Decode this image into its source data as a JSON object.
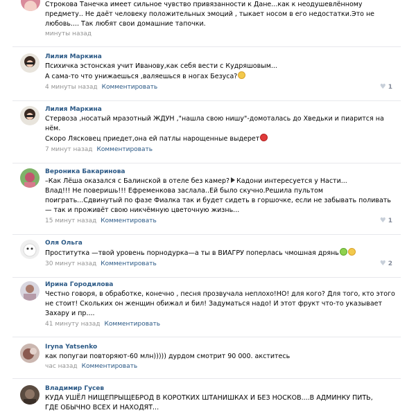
{
  "comments": [
    {
      "author": "",
      "lines": [
        "Строкова Танечка имеет сильное чувство привязанности к Дане...как к неодушевлённому",
        "предмету.. Не даёт человеку положительных эмоций , тыкает носом в его недостатки.Это не",
        "любовь.... Так любят свои домашние тапочки."
      ],
      "time": "минуты назад",
      "reply": "",
      "likes": ""
    },
    {
      "author": "Лилия Маркина",
      "lines": [
        "Психичка эстонская учит Иванову,как себя вести с Кудряшовым...",
        "А сама-то что унижаешься ,валяешься в ногах Безуса?"
      ],
      "time": "4 минуты назад",
      "reply": "Комментировать",
      "likes": "1"
    },
    {
      "author": "Лилия Маркина",
      "lines": [
        "Стервоза ,носатый мразотный ЖДУН ,\"нашла свою нишу\"-домоталась до Хведьки и пиарится на",
        "нём.",
        "Скоро Лясковец приедет,она ей патлы нарощенные выдерет"
      ],
      "time": "7 минут назад",
      "reply": "Комментировать",
      "likes": ""
    },
    {
      "author": "Вероника Бакаринова",
      "lines": [
        "–Как Лёша оказался с Балинской в отеле без камер?",
        "Кадони интересуется у Насти...",
        "Влад!!! Не поверишь!!! Ефременкова заслала..Ей было скучно.Решила пультом",
        "поиграть...Сдвинутый по фазе Фиалка так и будет сидеть в горшочке, если не забывать поливать",
        "— так и проживёт свою никчёмную цветочную жизнь..."
      ],
      "time": "15 минут назад",
      "reply": "Комментировать",
      "likes": "1"
    },
    {
      "author": "Оля Ольга",
      "lines": [
        "Проститутка —твой уровень порнодурка—а ты в ВИАГРУ поперлась чмошная дрянь"
      ],
      "time": "30 минут назад",
      "reply": "Комментировать",
      "likes": "2"
    },
    {
      "author": "Ирина Городилова",
      "lines": [
        "Честно говоря, в обработке, конечно , песня прозвучала неплохо!НО! для кого? Для того, кто этого",
        "не стоит! Скольких он женщин обижал и бил! Задуматься надо! И этот фрукт что-то указывает",
        "Захару и пр...."
      ],
      "time": "41 минуту назад",
      "reply": "Комментировать",
      "likes": ""
    },
    {
      "author": "Iryna Yatsenko",
      "lines": [
        "как попугаи повторяют-60 млн))))) дурдом смотрит 90 000. акститесь"
      ],
      "time": "час назад",
      "reply": "Комментировать",
      "likes": ""
    },
    {
      "author": "Владимир Гусев",
      "lines": [
        "КУДА УШЁЛ НИЩЕПРЫЩЕБРОД В КОРОТКИХ ШТАНИШКАХ И БЕЗ НОСКОВ....В АДМИНКУ ПИТЬ,",
        "ГДЕ ОБЫЧНО ВСЕХ И НАХОДЯТ..."
      ],
      "time": "",
      "reply": "",
      "likes": ""
    }
  ],
  "colors": {
    "author": "#2a5885",
    "meta": "#939393",
    "divider": "#e7e8ec",
    "like_heart": "#c7cfd9"
  }
}
